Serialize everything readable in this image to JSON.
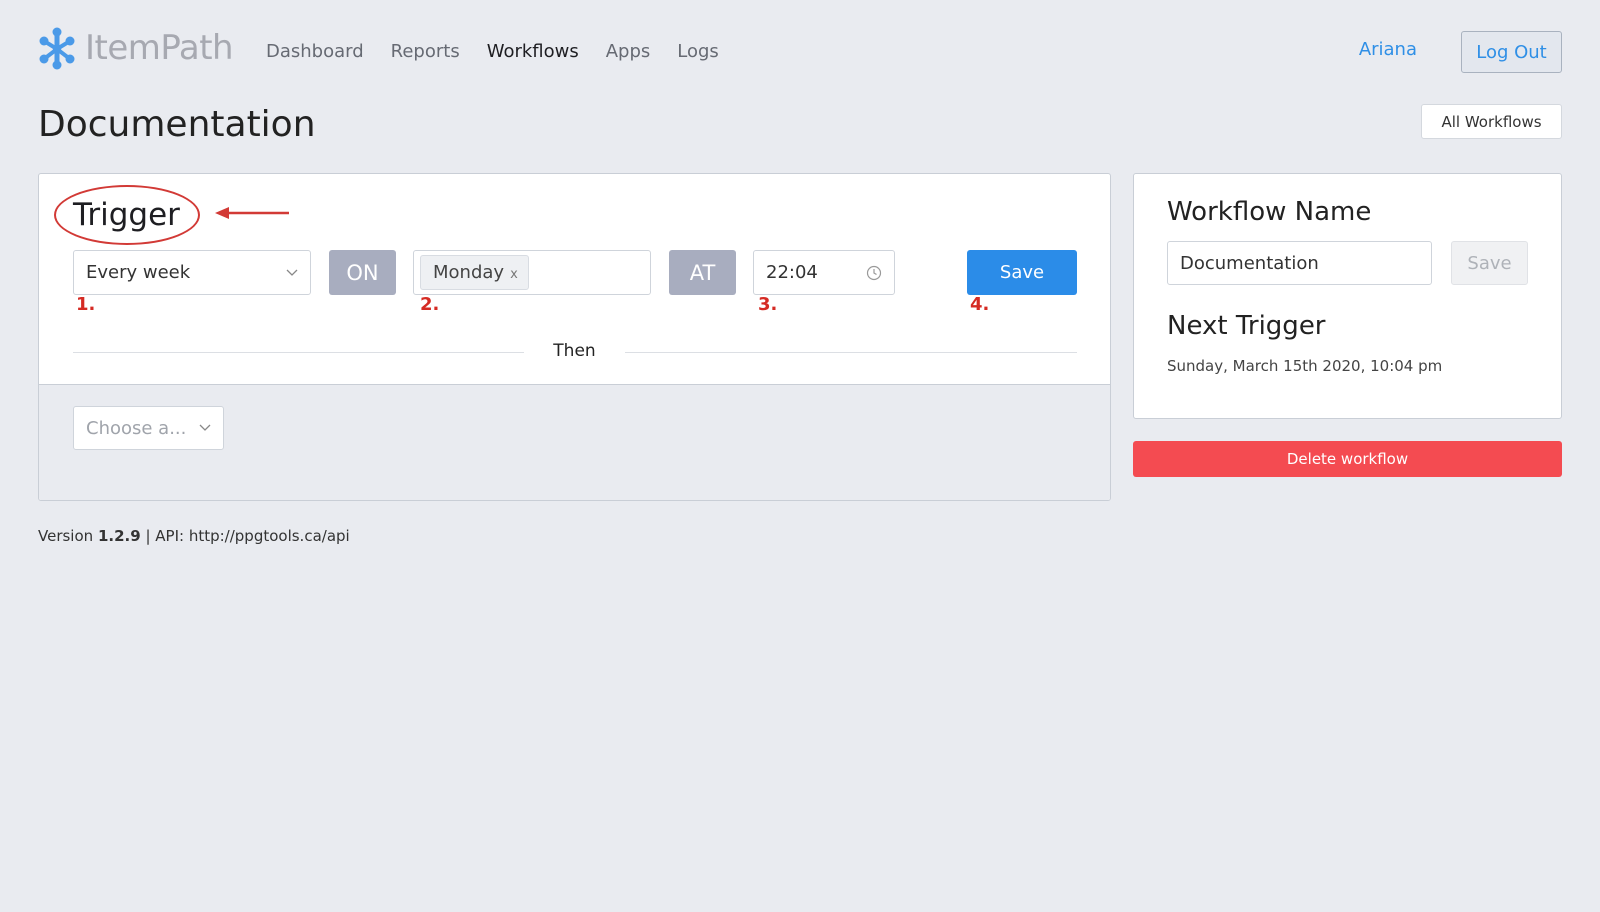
{
  "header": {
    "logo_text": "ItemPath",
    "nav": [
      {
        "label": "Dashboard",
        "active": false
      },
      {
        "label": "Reports",
        "active": false
      },
      {
        "label": "Workflows",
        "active": true
      },
      {
        "label": "Apps",
        "active": false
      },
      {
        "label": "Logs",
        "active": false
      }
    ],
    "user_name": "Ariana",
    "logout_label": "Log Out"
  },
  "page": {
    "title": "Documentation",
    "all_workflows_label": "All Workflows"
  },
  "trigger": {
    "title": "Trigger",
    "frequency": "Every week",
    "on_label": "ON",
    "day_tag": "Monday",
    "tag_remove": "x",
    "at_label": "AT",
    "time": "22:04",
    "save_label": "Save",
    "steps": [
      "1.",
      "2.",
      "3.",
      "4."
    ],
    "then_label": "Then",
    "action_placeholder": "Choose a..."
  },
  "side": {
    "workflow_name_title": "Workflow Name",
    "workflow_name_value": "Documentation",
    "save_label": "Save",
    "next_trigger_title": "Next Trigger",
    "next_trigger_value": "Sunday, March 15th 2020, 10:04 pm",
    "delete_label": "Delete workflow"
  },
  "footer": {
    "version_prefix": "Version",
    "version": "1.2.9",
    "api_text": "| API: http://ppgtools.ca/api"
  },
  "colors": {
    "accent": "#2b8ce8",
    "danger": "#f44b51",
    "annotation": "#d52b24",
    "background": "#e9ebf0"
  }
}
